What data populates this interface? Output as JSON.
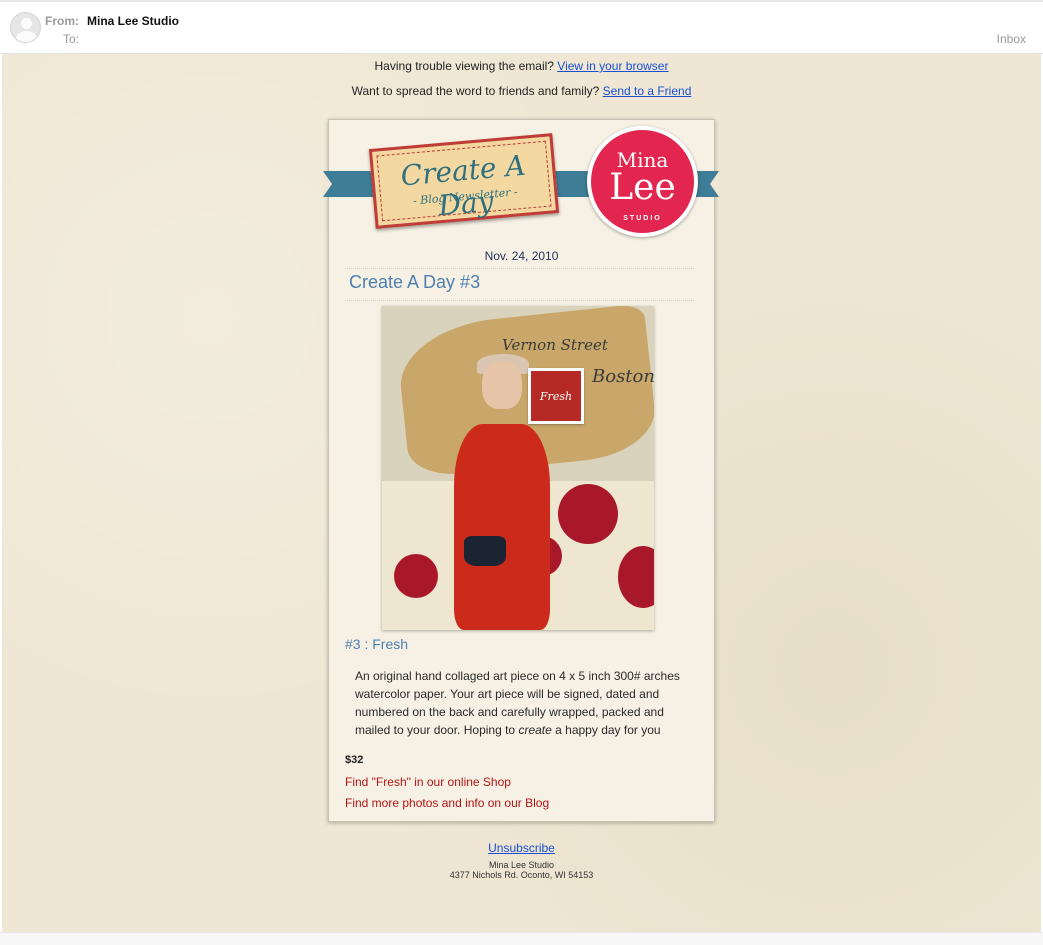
{
  "header": {
    "from_label": "From:",
    "from_name": "Mina Lee Studio",
    "to_label": "To:",
    "mailbox": "Inbox"
  },
  "top_lines": {
    "line1_text": "Having trouble viewing the email?",
    "line1_link": "View in your browser",
    "line2_text": "Want to spread the word to friends and family?",
    "line2_link": "Send to a Friend"
  },
  "banner": {
    "title": "Create A Day",
    "subtitle": "- Blog Newsletter -",
    "logo_line1": "Mina",
    "logo_line2": "Lee",
    "logo_line3": "STUDIO"
  },
  "post": {
    "date": "Nov. 24, 2010",
    "title": "Create A Day #3",
    "artwork_stamp": "Fresh",
    "item_title": "#3 : Fresh",
    "description_pre": "An original hand collaged art piece on 4 x 5 inch 300# arches watercolor paper. Your art piece will be signed, dated and numbered on the back and carefully wrapped, packed and mailed to your door. Hoping to",
    "description_em": "create",
    "description_post": "a happy day for you",
    "price": "$32",
    "shop_link": "Find \"Fresh\" in our online Shop",
    "blog_link": "Find more photos and info on our Blog"
  },
  "footer": {
    "unsubscribe": "Unsubscribe",
    "address_name": "Mina Lee Studio",
    "address_line": "4377 Nichols Rd. Oconto, WI 54153"
  },
  "colors": {
    "background": "#efe7d4",
    "card": "#f6f1e4",
    "ribbon": "#3d7d96",
    "logo": "#e2264f",
    "title_blue": "#4d7fb3",
    "link_red": "#b31418",
    "link_blue": "#1a4fd4"
  }
}
